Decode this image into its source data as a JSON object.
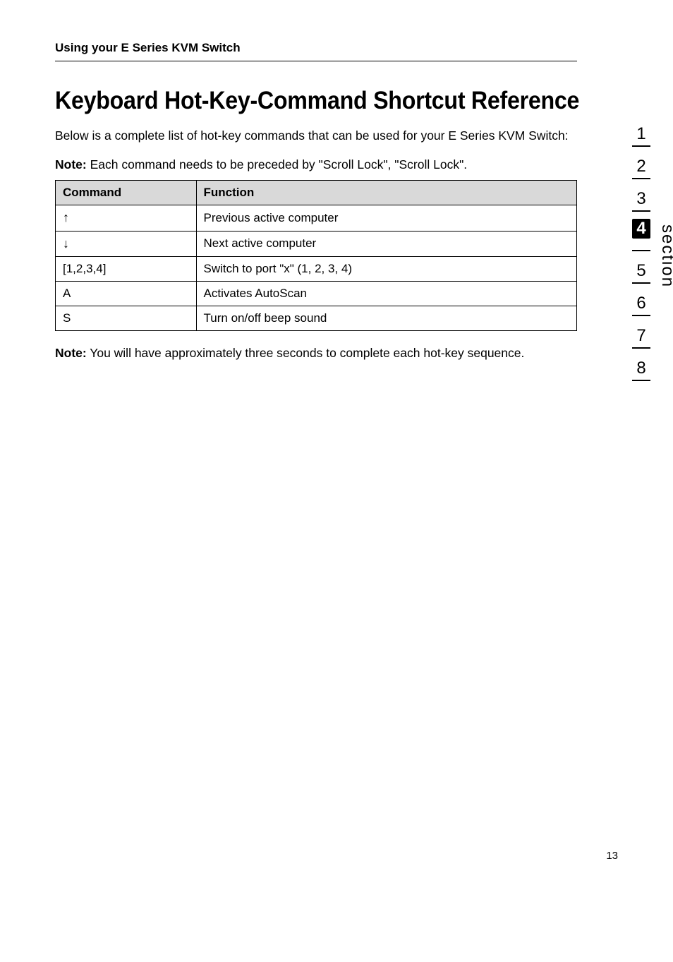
{
  "running_head": "Using your E Series KVM Switch",
  "title": "Keyboard Hot-Key-Command Shortcut Reference",
  "intro": "Below is a complete list of hot-key commands that can be used for your E Series KVM Switch:",
  "tablenote_bold": "Note:",
  "tablenote_rest": " Each command needs to be preceded by \"Scroll Lock\", \"Scroll Lock\".",
  "table": {
    "headers": {
      "command": "Command",
      "function": "Function"
    },
    "rows": [
      {
        "command": "↑",
        "function": "Previous active computer"
      },
      {
        "command": "↓",
        "function": "Next active computer"
      },
      {
        "command": "[1,2,3,4]",
        "function": "Switch to port \"x\" (1, 2, 3, 4)"
      },
      {
        "command": "A",
        "function": "Activates AutoScan"
      },
      {
        "command": "S",
        "function": "Turn on/off beep sound"
      }
    ]
  },
  "postnote_bold": "Note:",
  "postnote_rest": " You will have approximately three seconds to complete each hot-key sequence.",
  "sidenav": [
    "1",
    "2",
    "3",
    "4",
    "5",
    "6",
    "7",
    "8"
  ],
  "sidenav_active_index": 3,
  "section_label": "section",
  "page_number": "13",
  "chart_data": {
    "type": "table",
    "columns": [
      "Command",
      "Function"
    ],
    "rows": [
      [
        "↑",
        "Previous active computer"
      ],
      [
        "↓",
        "Next active computer"
      ],
      [
        "[1,2,3,4]",
        "Switch to port \"x\" (1, 2, 3, 4)"
      ],
      [
        "A",
        "Activates AutoScan"
      ],
      [
        "S",
        "Turn on/off beep sound"
      ]
    ]
  }
}
